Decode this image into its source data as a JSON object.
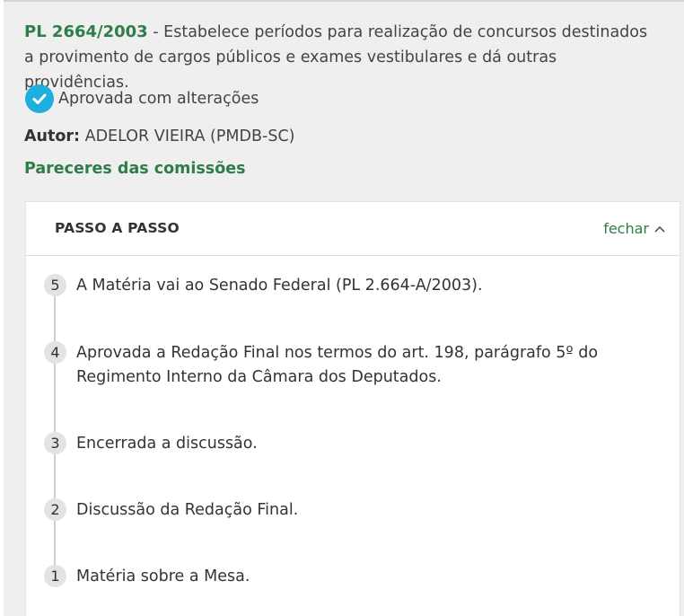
{
  "proposal": {
    "code": "PL 2664/2003",
    "separator": " - ",
    "description": "Estabelece períodos para realização de concursos destinados a provimento de cargos públicos e exames vestibulares e dá outras providências.",
    "status": "Aprovada com alterações",
    "author_label": "Autor:",
    "author_value": " ADELOR VIEIRA (PMDB-SC)",
    "committees_link": "Pareceres das comissões"
  },
  "steps_panel": {
    "title": "PASSO A PASSO",
    "toggle_label": "fechar",
    "steps": [
      {
        "number": "5",
        "text": "A Matéria vai ao Senado Federal (PL 2.664-A/2003)."
      },
      {
        "number": "4",
        "text": "Aprovada a Redação Final nos termos do art. 198, parágrafo 5º do Regimento Interno da Câmara dos Deputados."
      },
      {
        "number": "3",
        "text": "Encerrada a discussão."
      },
      {
        "number": "2",
        "text": "Discussão da Redação Final."
      },
      {
        "number": "1",
        "text": "Matéria sobre a Mesa."
      }
    ]
  },
  "colors": {
    "accent_green": "#2e7d4a",
    "check_blue": "#1eaee0",
    "panel_bg": "#efefef"
  },
  "icons": {
    "status": "check-circle-icon",
    "toggle": "chevron-up-icon"
  }
}
